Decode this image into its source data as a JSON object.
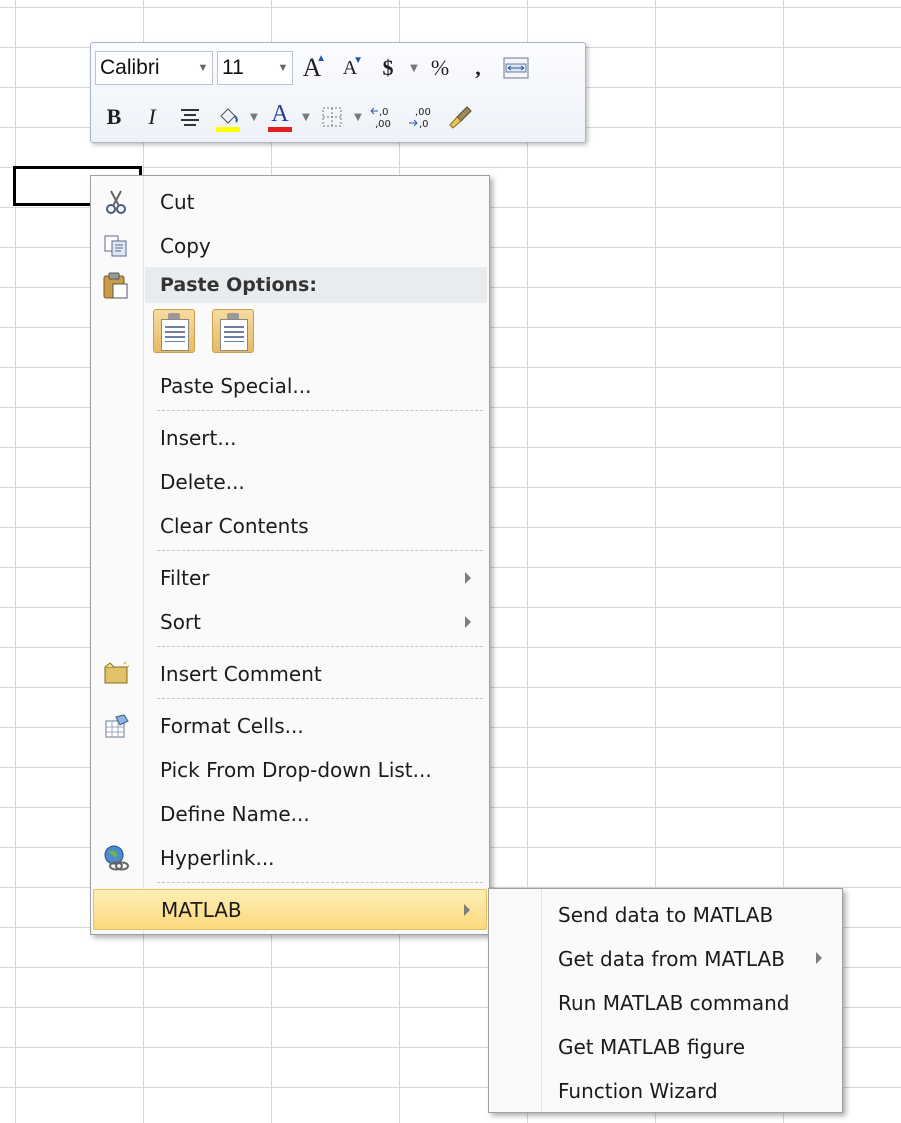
{
  "mini_toolbar": {
    "font_name": "Calibri",
    "font_size": "11",
    "grow_font": "A",
    "shrink_font": "A",
    "currency": "$",
    "percent": "%",
    "comma": ",",
    "bold": "B",
    "italic": "I",
    "font_color_glyph": "A",
    "highlight_color": "#ffff00",
    "font_color": "#e02020"
  },
  "context_menu": {
    "cut": "Cut",
    "copy": "Copy",
    "paste_options": "Paste Options:",
    "paste_special": "Paste Special...",
    "insert": "Insert...",
    "delete": "Delete...",
    "clear_contents": "Clear Contents",
    "filter": "Filter",
    "sort": "Sort",
    "insert_comment": "Insert Comment",
    "format_cells": "Format Cells...",
    "pick_from_list": "Pick From Drop-down List...",
    "define_name": "Define Name...",
    "hyperlink": "Hyperlink...",
    "matlab": "MATLAB"
  },
  "matlab_submenu": {
    "send_data": "Send data to MATLAB",
    "get_data": "Get data from MATLAB",
    "run_command": "Run MATLAB command",
    "get_figure": "Get MATLAB figure",
    "function_wizard": "Function Wizard"
  }
}
